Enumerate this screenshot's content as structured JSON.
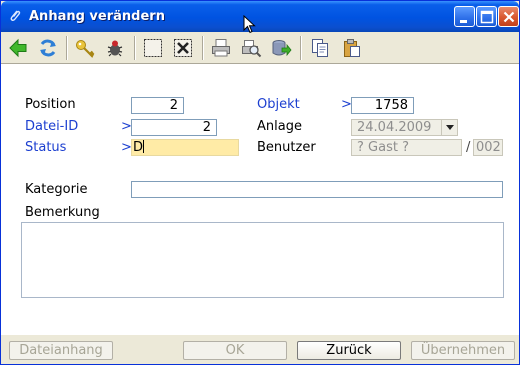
{
  "window": {
    "title": "Anhang verändern"
  },
  "toolbar": {
    "icons": [
      "back-arrow-icon",
      "refresh-icon",
      "key-icon",
      "bug-icon",
      "select-box-icon",
      "delete-x-icon",
      "print-icon",
      "print-preview-icon",
      "export-icon",
      "copy-icon",
      "paste-icon"
    ]
  },
  "form": {
    "position": {
      "label": "Position",
      "value": "2"
    },
    "datei_id": {
      "label": "Datei-ID",
      "marker": ">",
      "value": "2"
    },
    "status": {
      "label": "Status",
      "marker": ">",
      "value": "D"
    },
    "objekt": {
      "label": "Objekt",
      "marker": ">",
      "value": "1758"
    },
    "anlage": {
      "label": "Anlage",
      "value": "24.04.2009"
    },
    "benutzer": {
      "label": "Benutzer",
      "value": "? Gast ?",
      "separator": "/",
      "code": "002"
    },
    "kategorie": {
      "label": "Kategorie",
      "value": ""
    },
    "bemerkung": {
      "label": "Bemerkung",
      "value": ""
    }
  },
  "buttons": {
    "dateianhang": "Dateianhang",
    "ok": "OK",
    "zurueck": "Zurück",
    "uebernehmen": "Übernehmen"
  },
  "colors": {
    "titlebar": "#0053E1",
    "label_blue": "#1C3FD0",
    "status_field": "#FFEBA6"
  }
}
